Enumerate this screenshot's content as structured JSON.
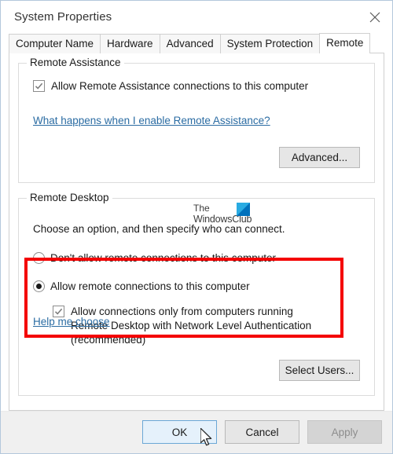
{
  "window": {
    "title": "System Properties",
    "close_icon": "close-icon"
  },
  "tabs": [
    {
      "label": "Computer Name",
      "active": false
    },
    {
      "label": "Hardware",
      "active": false
    },
    {
      "label": "Advanced",
      "active": false
    },
    {
      "label": "System Protection",
      "active": false
    },
    {
      "label": "Remote",
      "active": true
    }
  ],
  "remote_assistance": {
    "group_title": "Remote Assistance",
    "checkbox_label": "Allow Remote Assistance connections to this computer",
    "checkbox_checked": true,
    "link_label": "What happens when I enable Remote Assistance?",
    "advanced_button": "Advanced..."
  },
  "remote_desktop": {
    "group_title": "Remote Desktop",
    "instruction": "Choose an option, and then specify who can connect.",
    "option_deny": "Don't allow remote connections to this computer",
    "option_deny_selected": false,
    "option_allow": "Allow remote connections to this computer",
    "option_allow_selected": true,
    "nla_checkbox_label": "Allow connections only from computers running Remote Desktop with Network Level Authentication (recommended)",
    "nla_checkbox_checked": true,
    "help_link": "Help me choose",
    "select_users_button": "Select Users..."
  },
  "watermark": {
    "line1": "The",
    "line2": "WindowsClub",
    "logo_color_light": "#29abe2",
    "logo_color_dark": "#0071bc"
  },
  "footer": {
    "ok_label": "OK",
    "cancel_label": "Cancel",
    "apply_label": "Apply",
    "apply_disabled": true
  },
  "highlight": {
    "color": "#f40000"
  }
}
